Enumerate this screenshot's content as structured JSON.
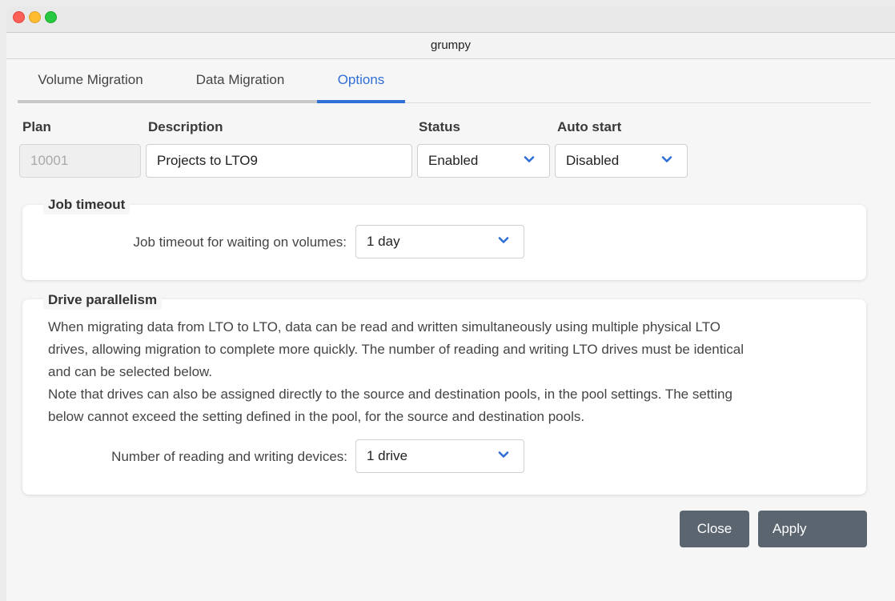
{
  "window": {
    "title": "grumpy"
  },
  "tabs": [
    {
      "label": "Volume Migration",
      "active": false
    },
    {
      "label": "Data Migration",
      "active": false
    },
    {
      "label": "Options",
      "active": true
    }
  ],
  "form": {
    "plan": {
      "label": "Plan",
      "value": "10001"
    },
    "description": {
      "label": "Description",
      "value": "Projects to LTO9"
    },
    "status": {
      "label": "Status",
      "value": "Enabled"
    },
    "auto_start": {
      "label": "Auto start",
      "value": "Disabled"
    }
  },
  "job_timeout": {
    "title": "Job timeout",
    "label": "Job timeout for waiting on volumes:",
    "value": "1 day"
  },
  "drive_parallelism": {
    "title": "Drive parallelism",
    "lines": [
      "When migrating data from LTO to LTO, data can be read and written simultaneously using multiple physical LTO",
      "drives, allowing migration to complete more quickly. The number of reading and writing LTO drives must be identical",
      "and can be selected below.",
      "Note that drives can also be assigned directly to the source and destination pools, in the pool settings. The setting",
      "below cannot exceed the setting defined in the pool, for the source and destination pools."
    ],
    "label": "Number of reading and writing devices:",
    "value": "1 drive"
  },
  "buttons": {
    "close": "Close",
    "apply": "Apply"
  },
  "colors": {
    "accent": "#2f6fd6",
    "button": "#5b6570"
  },
  "icons": {
    "dropdown": "chevron-down-icon"
  }
}
